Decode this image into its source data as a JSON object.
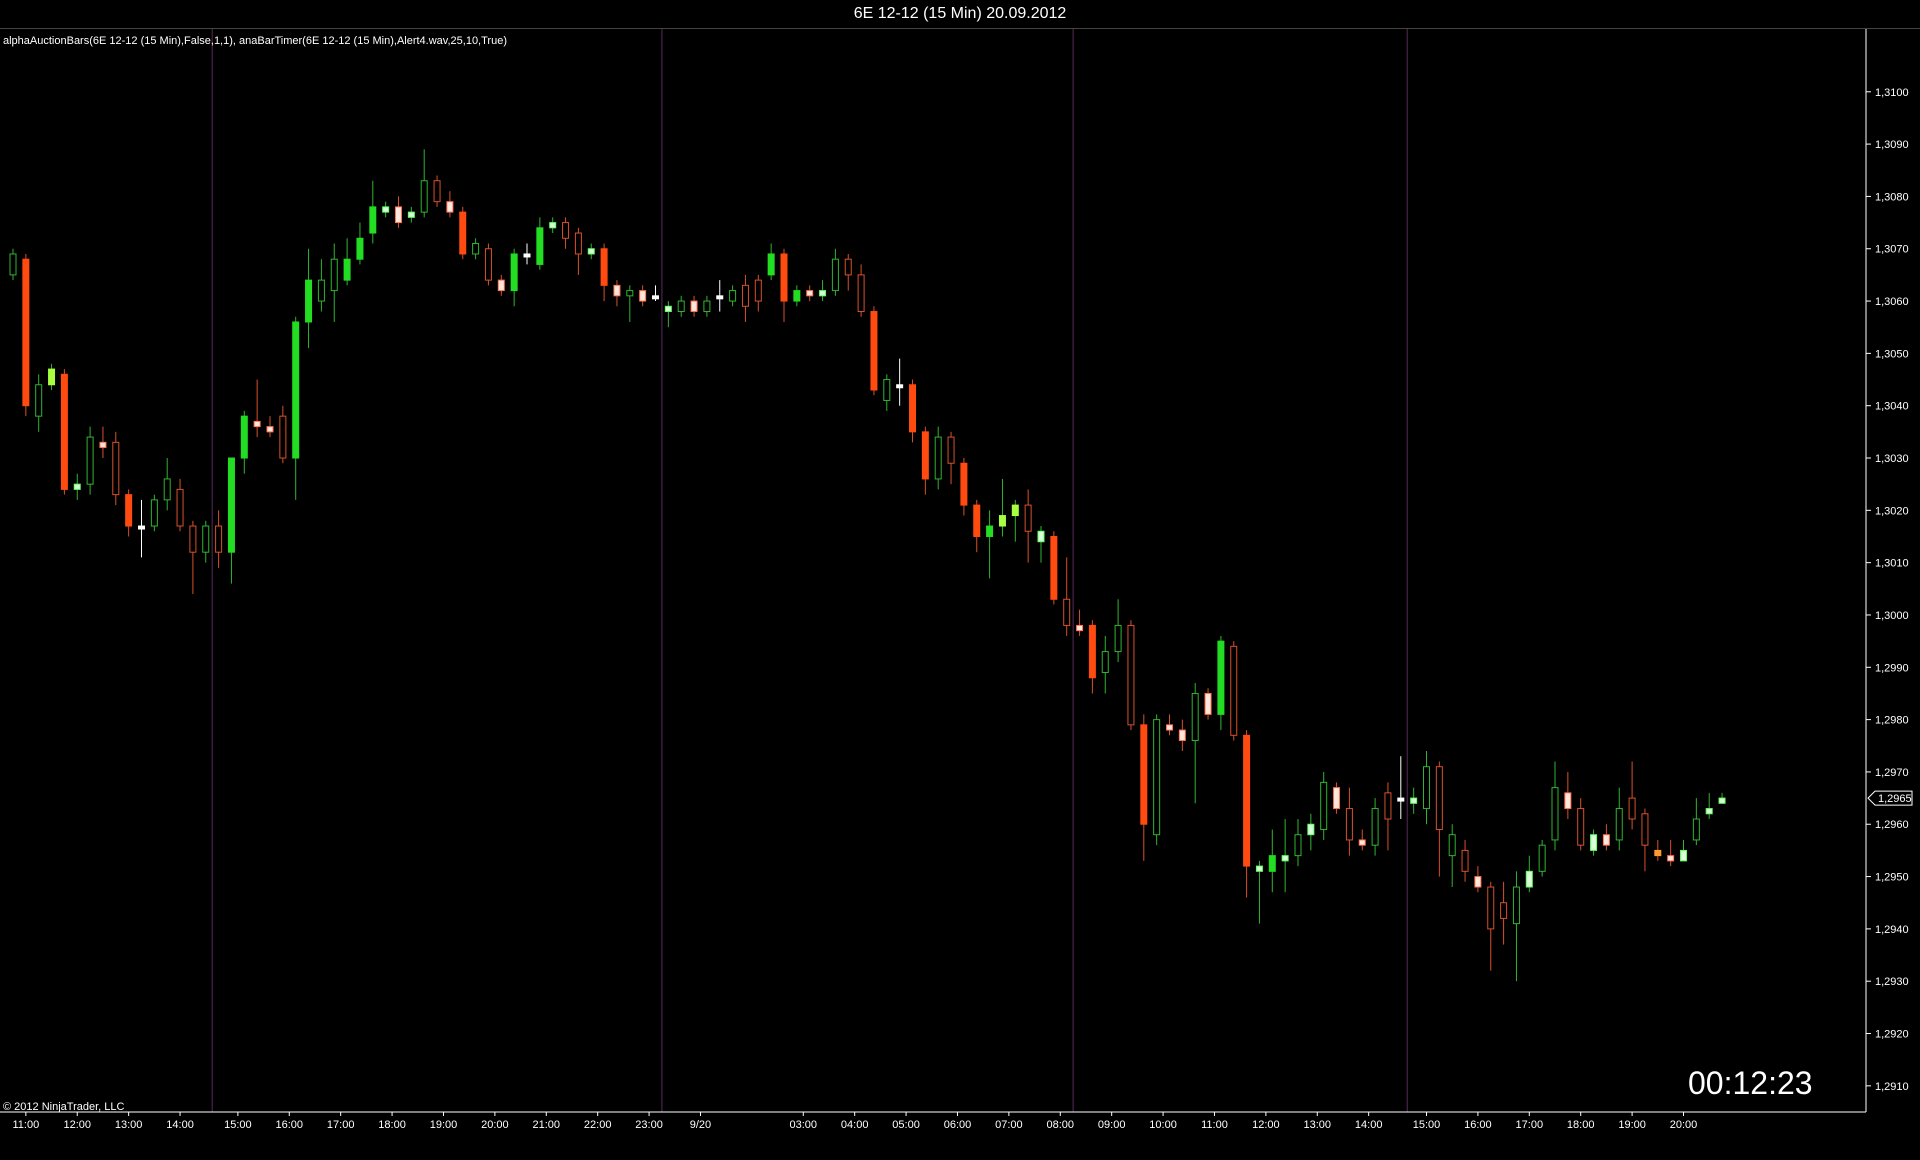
{
  "window": {
    "title": "6E 12-12 (15 Min)  20.09.2012"
  },
  "indicator_label": "alphaAuctionBars(6E 12-12 (15 Min),False,1,1), anaBarTimer(6E 12-12 (15 Min),Alert4.wav,25,10,True)",
  "copyright": "© 2012 NinjaTrader, LLC",
  "timer": "00:12:23",
  "colors": {
    "background": "#000000",
    "up_strong": "#22dd22",
    "up_hollow": "#2fb52f",
    "down_strong": "#ff4a10",
    "down_hollow": "#d8502a",
    "neutral_light": "#ffe6dc",
    "neutral_white": "#ffffff",
    "session_line": "#5a2a5a",
    "axis": "#ffffff"
  },
  "chart_data": {
    "type": "candlestick",
    "title": "6E 12-12 (15 Min)  20.09.2012",
    "ylim": [
      1.2905,
      1.3112
    ],
    "y_ticks": [
      "1,3100",
      "1,3090",
      "1,3080",
      "1,3070",
      "1,3060",
      "1,3050",
      "1,3040",
      "1,3030",
      "1,3020",
      "1,3010",
      "1,3000",
      "1,2990",
      "1,2980",
      "1,2970",
      "1,2960",
      "1,2950",
      "1,2940",
      "1,2930",
      "1,2920",
      "1,2910"
    ],
    "y_tick_values": [
      1.31,
      1.309,
      1.308,
      1.307,
      1.306,
      1.305,
      1.304,
      1.303,
      1.302,
      1.301,
      1.3,
      1.299,
      1.298,
      1.297,
      1.296,
      1.295,
      1.294,
      1.293,
      1.292,
      1.291
    ],
    "last_price": "1,2965",
    "last_price_value": 1.2965,
    "x_ticks": [
      {
        "label": "11:00",
        "bar": 1
      },
      {
        "label": "12:00",
        "bar": 5
      },
      {
        "label": "13:00",
        "bar": 9
      },
      {
        "label": "14:00",
        "bar": 13
      },
      {
        "label": "15:00",
        "bar": 17.5
      },
      {
        "label": "16:00",
        "bar": 21.5
      },
      {
        "label": "17:00",
        "bar": 25.5
      },
      {
        "label": "18:00",
        "bar": 29.5
      },
      {
        "label": "19:00",
        "bar": 33.5
      },
      {
        "label": "20:00",
        "bar": 37.5
      },
      {
        "label": "21:00",
        "bar": 41.5
      },
      {
        "label": "22:00",
        "bar": 45.5
      },
      {
        "label": "23:00",
        "bar": 49.5
      },
      {
        "label": "9/20",
        "bar": 53.5
      },
      {
        "label": "03:00",
        "bar": 61.5
      },
      {
        "label": "04:00",
        "bar": 65.5
      },
      {
        "label": "05:00",
        "bar": 69.5
      },
      {
        "label": "06:00",
        "bar": 73.5
      },
      {
        "label": "07:00",
        "bar": 77.5
      },
      {
        "label": "08:00",
        "bar": 81.5
      },
      {
        "label": "09:00",
        "bar": 85.5
      },
      {
        "label": "10:00",
        "bar": 89.5
      },
      {
        "label": "11:00",
        "bar": 93.5
      },
      {
        "label": "12:00",
        "bar": 97.5
      },
      {
        "label": "13:00",
        "bar": 101.5
      },
      {
        "label": "14:00",
        "bar": 105.5
      },
      {
        "label": "15:00",
        "bar": 110
      },
      {
        "label": "16:00",
        "bar": 114
      },
      {
        "label": "17:00",
        "bar": 118
      },
      {
        "label": "18:00",
        "bar": 122
      },
      {
        "label": "19:00",
        "bar": 126
      },
      {
        "label": "20:00",
        "bar": 130
      }
    ],
    "session_breaks": [
      15.5,
      50.5,
      82.5,
      108.5
    ],
    "styles": {
      "G": {
        "fill": "#22dd22",
        "stroke": "#22dd22",
        "wick": "#2fb52f"
      },
      "g": {
        "fill": "none",
        "stroke": "#2fb52f",
        "wick": "#2fb52f"
      },
      "R": {
        "fill": "#ff4a10",
        "stroke": "#ff4a10",
        "wick": "#d8502a"
      },
      "r": {
        "fill": "none",
        "stroke": "#d8502a",
        "wick": "#d8502a"
      },
      "P": {
        "fill": "#ffe6dc",
        "stroke": "#ff7050",
        "wick": "#d8502a"
      },
      "L": {
        "fill": "#d8ffd8",
        "stroke": "#60ff60",
        "wick": "#2fb52f"
      },
      "W": {
        "fill": "#ffffff",
        "stroke": "#ffffff",
        "wick": "#ffffff"
      },
      "Y": {
        "fill": "#a8ff40",
        "stroke": "#a8ff40",
        "wick": "#2fb52f"
      },
      "O": {
        "fill": "#ff9a30",
        "stroke": "#ff9a30",
        "wick": "#d8502a"
      }
    },
    "bars": [
      [
        "g",
        1.3065,
        1.3069,
        1.307,
        1.3064
      ],
      [
        "R",
        1.3068,
        1.304,
        1.3069,
        1.3038
      ],
      [
        "g",
        1.3038,
        1.3044,
        1.3046,
        1.3035
      ],
      [
        "Y",
        1.3044,
        1.3047,
        1.3048,
        1.3043
      ],
      [
        "R",
        1.3046,
        1.3024,
        1.3047,
        1.3023
      ],
      [
        "L",
        1.3024,
        1.3025,
        1.3027,
        1.3022
      ],
      [
        "g",
        1.3025,
        1.3034,
        1.3036,
        1.3023
      ],
      [
        "P",
        1.3033,
        1.3032,
        1.3036,
        1.303
      ],
      [
        "r",
        1.3033,
        1.3023,
        1.3035,
        1.3021
      ],
      [
        "R",
        1.3023,
        1.3017,
        1.3024,
        1.3015
      ],
      [
        "W",
        1.3017,
        1.3017,
        1.3022,
        1.3011
      ],
      [
        "g",
        1.3017,
        1.3022,
        1.3023,
        1.3016
      ],
      [
        "g",
        1.3022,
        1.3026,
        1.303,
        1.302
      ],
      [
        "r",
        1.3024,
        1.3017,
        1.3026,
        1.3016
      ],
      [
        "r",
        1.3017,
        1.3012,
        1.3018,
        1.3004
      ],
      [
        "g",
        1.3012,
        1.3017,
        1.3018,
        1.301
      ],
      [
        "r",
        1.3017,
        1.3012,
        1.302,
        1.3009
      ],
      [
        "G",
        1.3012,
        1.303,
        1.303,
        1.3006
      ],
      [
        "G",
        1.303,
        1.3038,
        1.3039,
        1.3027
      ],
      [
        "P",
        1.3037,
        1.3036,
        1.3045,
        1.3034
      ],
      [
        "P",
        1.3036,
        1.3035,
        1.3038,
        1.3034
      ],
      [
        "r",
        1.3038,
        1.303,
        1.304,
        1.3029
      ],
      [
        "G",
        1.303,
        1.3056,
        1.3057,
        1.3022
      ],
      [
        "G",
        1.3056,
        1.3064,
        1.307,
        1.3051
      ],
      [
        "g",
        1.306,
        1.3064,
        1.3068,
        1.3058
      ],
      [
        "g",
        1.3062,
        1.3068,
        1.3071,
        1.3056
      ],
      [
        "G",
        1.3064,
        1.3068,
        1.3072,
        1.3063
      ],
      [
        "G",
        1.3068,
        1.3072,
        1.3075,
        1.3067
      ],
      [
        "G",
        1.3073,
        1.3078,
        1.3083,
        1.3071
      ],
      [
        "L",
        1.3077,
        1.3078,
        1.3079,
        1.3076
      ],
      [
        "P",
        1.3078,
        1.3075,
        1.308,
        1.3074
      ],
      [
        "L",
        1.3076,
        1.3077,
        1.3078,
        1.3075
      ],
      [
        "g",
        1.3077,
        1.3083,
        1.3089,
        1.3076
      ],
      [
        "r",
        1.3083,
        1.3079,
        1.3084,
        1.3078
      ],
      [
        "P",
        1.3079,
        1.3077,
        1.3081,
        1.3076
      ],
      [
        "R",
        1.3077,
        1.3069,
        1.3078,
        1.3068
      ],
      [
        "g",
        1.3069,
        1.3071,
        1.3072,
        1.3068
      ],
      [
        "r",
        1.307,
        1.3064,
        1.3071,
        1.3063
      ],
      [
        "P",
        1.3064,
        1.3062,
        1.3065,
        1.3061
      ],
      [
        "G",
        1.3062,
        1.3069,
        1.307,
        1.3059
      ],
      [
        "W",
        1.3069,
        1.3069,
        1.3071,
        1.3067
      ],
      [
        "G",
        1.3067,
        1.3074,
        1.3076,
        1.3066
      ],
      [
        "L",
        1.3074,
        1.3075,
        1.3076,
        1.3073
      ],
      [
        "r",
        1.3075,
        1.3072,
        1.3076,
        1.307
      ],
      [
        "r",
        1.3073,
        1.3069,
        1.3074,
        1.3065
      ],
      [
        "L",
        1.3069,
        1.307,
        1.3071,
        1.3068
      ],
      [
        "R",
        1.307,
        1.3063,
        1.3071,
        1.306
      ],
      [
        "P",
        1.3063,
        1.3061,
        1.3064,
        1.3059
      ],
      [
        "g",
        1.3061,
        1.3062,
        1.3063,
        1.3056
      ],
      [
        "P",
        1.3062,
        1.306,
        1.3063,
        1.3059
      ],
      [
        "W",
        1.3061,
        1.3061,
        1.3063,
        1.306
      ],
      [
        "L",
        1.3058,
        1.3059,
        1.306,
        1.3055
      ],
      [
        "g",
        1.3058,
        1.306,
        1.3061,
        1.3057
      ],
      [
        "P",
        1.306,
        1.3058,
        1.3061,
        1.3057
      ],
      [
        "g",
        1.3058,
        1.306,
        1.3061,
        1.3057
      ],
      [
        "W",
        1.3061,
        1.3061,
        1.3064,
        1.3058
      ],
      [
        "g",
        1.306,
        1.3062,
        1.3063,
        1.3059
      ],
      [
        "r",
        1.3063,
        1.3059,
        1.3065,
        1.3056
      ],
      [
        "r",
        1.3064,
        1.306,
        1.3065,
        1.3058
      ],
      [
        "G",
        1.3065,
        1.3069,
        1.3071,
        1.3064
      ],
      [
        "R",
        1.3069,
        1.306,
        1.307,
        1.3056
      ],
      [
        "G",
        1.306,
        1.3062,
        1.3063,
        1.3059
      ],
      [
        "P",
        1.3062,
        1.3061,
        1.3063,
        1.306
      ],
      [
        "L",
        1.3061,
        1.3062,
        1.3064,
        1.306
      ],
      [
        "g",
        1.3062,
        1.3068,
        1.307,
        1.3061
      ],
      [
        "r",
        1.3068,
        1.3065,
        1.3069,
        1.3062
      ],
      [
        "r",
        1.3065,
        1.3058,
        1.3067,
        1.3057
      ],
      [
        "R",
        1.3058,
        1.3043,
        1.3059,
        1.3042
      ],
      [
        "g",
        1.3041,
        1.3045,
        1.3046,
        1.3039
      ],
      [
        "W",
        1.3044,
        1.3044,
        1.3049,
        1.304
      ],
      [
        "R",
        1.3044,
        1.3035,
        1.3045,
        1.3033
      ],
      [
        "R",
        1.3035,
        1.3026,
        1.3036,
        1.3023
      ],
      [
        "g",
        1.3026,
        1.3034,
        1.3036,
        1.3024
      ],
      [
        "r",
        1.3034,
        1.3029,
        1.3035,
        1.3025
      ],
      [
        "R",
        1.3029,
        1.3021,
        1.303,
        1.3019
      ],
      [
        "R",
        1.3021,
        1.3015,
        1.3022,
        1.3012
      ],
      [
        "G",
        1.3015,
        1.3017,
        1.302,
        1.3007
      ],
      [
        "Y",
        1.3017,
        1.3019,
        1.3026,
        1.3015
      ],
      [
        "Y",
        1.3019,
        1.3021,
        1.3022,
        1.3014
      ],
      [
        "r",
        1.3021,
        1.3016,
        1.3024,
        1.301
      ],
      [
        "L",
        1.3016,
        1.3014,
        1.3017,
        1.301
      ],
      [
        "R",
        1.3015,
        1.3003,
        1.3016,
        1.3002
      ],
      [
        "r",
        1.3003,
        1.2998,
        1.3011,
        1.2996
      ],
      [
        "P",
        1.2998,
        1.2997,
        1.3001,
        1.2996
      ],
      [
        "R",
        1.2998,
        1.2988,
        1.2999,
        1.2985
      ],
      [
        "g",
        1.2989,
        1.2993,
        1.2996,
        1.2985
      ],
      [
        "g",
        1.2993,
        1.2998,
        1.3003,
        1.2991
      ],
      [
        "r",
        1.2998,
        1.2979,
        1.2999,
        1.2978
      ],
      [
        "R",
        1.2979,
        1.296,
        1.2981,
        1.2953
      ],
      [
        "g",
        1.2958,
        1.298,
        1.2981,
        1.2956
      ],
      [
        "P",
        1.2979,
        1.2978,
        1.2981,
        1.2977
      ],
      [
        "P",
        1.2978,
        1.2976,
        1.298,
        1.2974
      ],
      [
        "g",
        1.2976,
        1.2985,
        1.2987,
        1.2964
      ],
      [
        "P",
        1.2985,
        1.2981,
        1.2986,
        1.298
      ],
      [
        "G",
        1.2981,
        1.2995,
        1.2996,
        1.2978
      ],
      [
        "r",
        1.2994,
        1.2977,
        1.2995,
        1.2976
      ],
      [
        "R",
        1.2977,
        1.2952,
        1.2978,
        1.2946
      ],
      [
        "L",
        1.2951,
        1.2952,
        1.2953,
        1.2941
      ],
      [
        "G",
        1.2951,
        1.2954,
        1.2959,
        1.2947
      ],
      [
        "L",
        1.2953,
        1.2954,
        1.2961,
        1.2947
      ],
      [
        "g",
        1.2954,
        1.2958,
        1.2961,
        1.2952
      ],
      [
        "L",
        1.2958,
        1.296,
        1.2962,
        1.2955
      ],
      [
        "g",
        1.2959,
        1.2968,
        1.297,
        1.2957
      ],
      [
        "P",
        1.2967,
        1.2963,
        1.2968,
        1.2962
      ],
      [
        "r",
        1.2963,
        1.2957,
        1.2967,
        1.2954
      ],
      [
        "P",
        1.2957,
        1.2956,
        1.2959,
        1.2955
      ],
      [
        "g",
        1.2956,
        1.2963,
        1.2965,
        1.2954
      ],
      [
        "r",
        1.2966,
        1.2961,
        1.2968,
        1.2955
      ],
      [
        "W",
        1.2965,
        1.2965,
        1.2973,
        1.2961
      ],
      [
        "L",
        1.2964,
        1.2965,
        1.2967,
        1.2962
      ],
      [
        "g",
        1.2963,
        1.2971,
        1.2974,
        1.296
      ],
      [
        "r",
        1.2971,
        1.2959,
        1.2972,
        1.295
      ],
      [
        "g",
        1.2954,
        1.2958,
        1.296,
        1.2948
      ],
      [
        "r",
        1.2955,
        1.2951,
        1.2957,
        1.2949
      ],
      [
        "P",
        1.295,
        1.2948,
        1.2952,
        1.2947
      ],
      [
        "r",
        1.2948,
        1.294,
        1.2949,
        1.2932
      ],
      [
        "r",
        1.2945,
        1.2942,
        1.2949,
        1.2937
      ],
      [
        "g",
        1.2941,
        1.2948,
        1.2951,
        1.293
      ],
      [
        "L",
        1.2948,
        1.2951,
        1.2954,
        1.2947
      ],
      [
        "g",
        1.2951,
        1.2956,
        1.2957,
        1.295
      ],
      [
        "g",
        1.2957,
        1.2967,
        1.2972,
        1.2955
      ],
      [
        "P",
        1.2966,
        1.2963,
        1.297,
        1.2961
      ],
      [
        "r",
        1.2963,
        1.2956,
        1.2965,
        1.2955
      ],
      [
        "L",
        1.2955,
        1.2958,
        1.2959,
        1.2954
      ],
      [
        "P",
        1.2958,
        1.2956,
        1.296,
        1.2955
      ],
      [
        "g",
        1.2957,
        1.2963,
        1.2967,
        1.2955
      ],
      [
        "r",
        1.2965,
        1.2961,
        1.2972,
        1.2959
      ],
      [
        "r",
        1.2962,
        1.2956,
        1.2963,
        1.2951
      ],
      [
        "O",
        1.2955,
        1.2954,
        1.2957,
        1.2953
      ],
      [
        "P",
        1.2954,
        1.2953,
        1.2957,
        1.2952
      ],
      [
        "L",
        1.2953,
        1.2955,
        1.2957,
        1.2953
      ],
      [
        "g",
        1.2957,
        1.2961,
        1.2965,
        1.2956
      ],
      [
        "L",
        1.2962,
        1.2963,
        1.2966,
        1.2961
      ],
      [
        "L",
        1.2964,
        1.2965,
        1.2966,
        1.2964
      ]
    ]
  }
}
